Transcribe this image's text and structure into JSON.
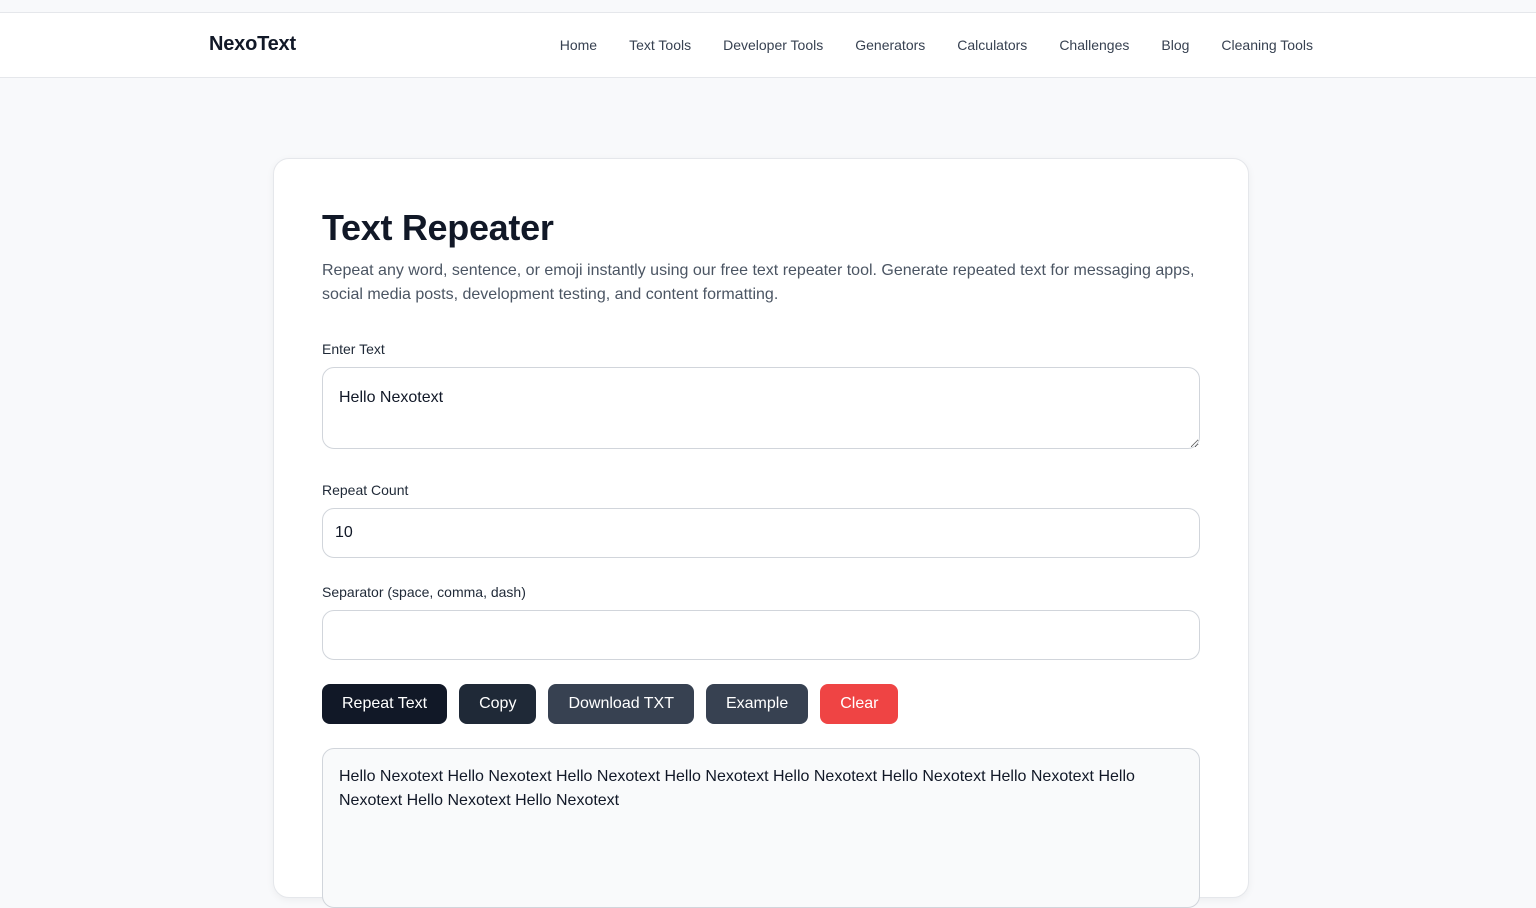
{
  "brand": "NexoText",
  "nav": {
    "items": [
      {
        "label": "Home"
      },
      {
        "label": "Text Tools"
      },
      {
        "label": "Developer Tools"
      },
      {
        "label": "Generators"
      },
      {
        "label": "Calculators"
      },
      {
        "label": "Challenges"
      },
      {
        "label": "Blog"
      },
      {
        "label": "Cleaning Tools"
      }
    ]
  },
  "tool": {
    "title": "Text Repeater",
    "description": "Repeat any word, sentence, or emoji instantly using our free text repeater tool. Generate repeated text for messaging apps, social media posts, development testing, and content formatting.",
    "text_label": "Enter Text",
    "text_value": "Hello Nexotext",
    "count_label": "Repeat Count",
    "count_value": "10",
    "separator_label": "Separator (space, comma, dash)",
    "separator_value": "",
    "buttons": {
      "repeat": "Repeat Text",
      "copy": "Copy",
      "download": "Download TXT",
      "example": "Example",
      "clear": "Clear"
    },
    "output": "Hello Nexotext Hello Nexotext Hello Nexotext Hello Nexotext Hello Nexotext Hello Nexotext Hello Nexotext Hello Nexotext Hello Nexotext Hello Nexotext"
  },
  "colors": {
    "primary": "#111827",
    "danger": "#ef4444",
    "secondary": "#374151"
  }
}
